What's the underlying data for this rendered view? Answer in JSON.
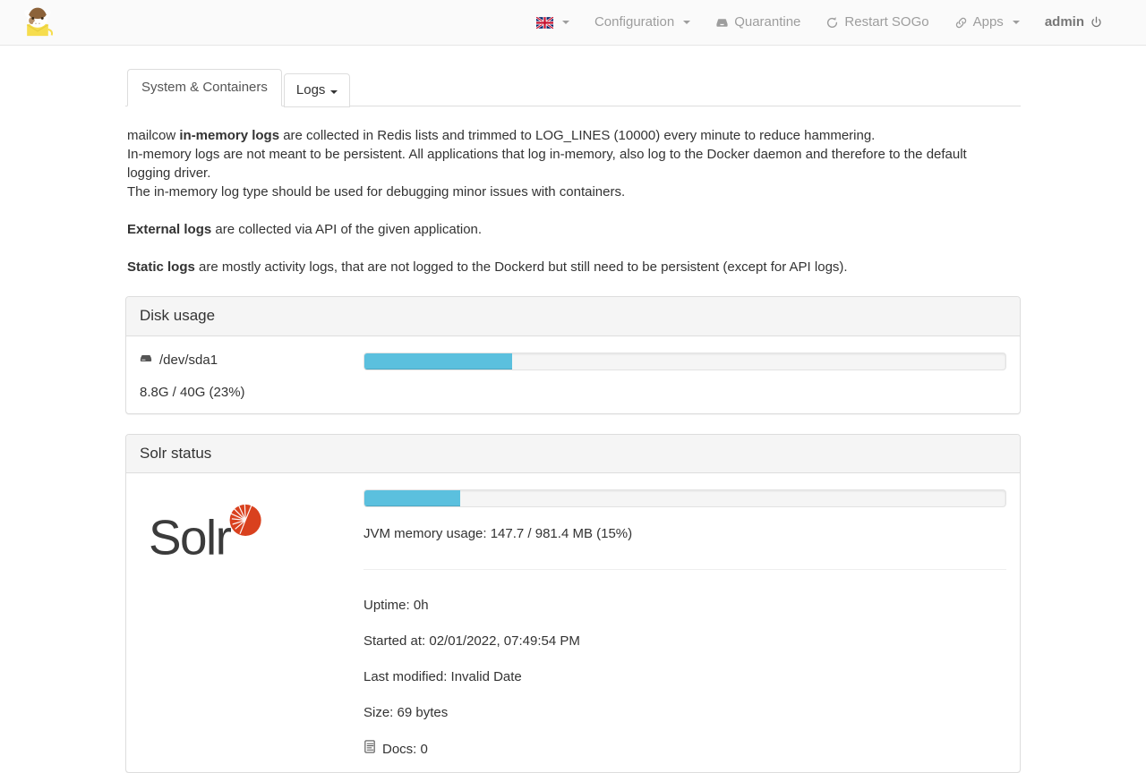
{
  "navbar": {
    "brand_icon": "mailcow-cow-logo",
    "language_icon": "uk-flag-icon",
    "items": [
      {
        "label": "Configuration",
        "icon": "",
        "caret": true
      },
      {
        "label": "Quarantine",
        "icon": "inbox-icon",
        "caret": false
      },
      {
        "label": "Restart SOGo",
        "icon": "refresh-icon",
        "caret": false
      },
      {
        "label": "Apps",
        "icon": "link-icon",
        "caret": true
      }
    ],
    "admin_label": "admin",
    "logout_icon": "power-off-icon"
  },
  "tabs": [
    {
      "label": "System & Containers",
      "active": true,
      "caret": false
    },
    {
      "label": "Logs",
      "active": false,
      "caret": true
    }
  ],
  "intro": {
    "p1_pre": "mailcow ",
    "p1_bold": "in-memory logs",
    "p1_post": " are collected in Redis lists and trimmed to LOG_LINES (10000) every minute to reduce hammering.",
    "p2": "In-memory logs are not meant to be persistent. All applications that log in-memory, also log to the Docker daemon and therefore to the default logging driver.",
    "p3": "The in-memory log type should be used for debugging minor issues with containers.",
    "p4_bold": "External logs",
    "p4_post": " are collected via API of the given application.",
    "p5_bold": "Static logs",
    "p5_post": " are mostly activity logs, that are not logged to the Dockerd but still need to be persistent (except for API logs)."
  },
  "disk_usage": {
    "panel_title": "Disk usage",
    "device_icon": "hard-drive-icon",
    "device": "/dev/sda1",
    "summary": "8.8G / 40G (23%)",
    "percent": 23,
    "bar_color": "#5bc0de"
  },
  "solr": {
    "panel_title": "Solr status",
    "logo_alt": "Solr",
    "memory_percent": 15,
    "memory_label": "JVM memory usage: 147.7 / 981.4 MB (15%)",
    "bar_color": "#5bc0de",
    "uptime": "Uptime: 0h",
    "started_at": "Started at: 02/01/2022, 07:49:54 PM",
    "last_modified": "Last modified: Invalid Date",
    "size": "Size: 69 bytes",
    "docs_icon": "file-text-icon",
    "docs": "Docs: 0"
  }
}
